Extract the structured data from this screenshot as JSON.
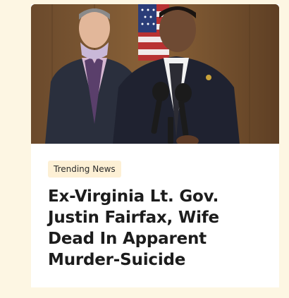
{
  "article": {
    "category": "Trending News",
    "headline": "Ex-Virginia Lt. Gov. Justin Fairfax, Wife Dead In Apparent Murder-Suicide",
    "image_description_icon": "news-photo"
  },
  "colors": {
    "page_background": "#fdf6e3",
    "card_background": "#ffffff",
    "badge_background": "#fdf0d5",
    "headline_text": "#1c1c1c"
  }
}
